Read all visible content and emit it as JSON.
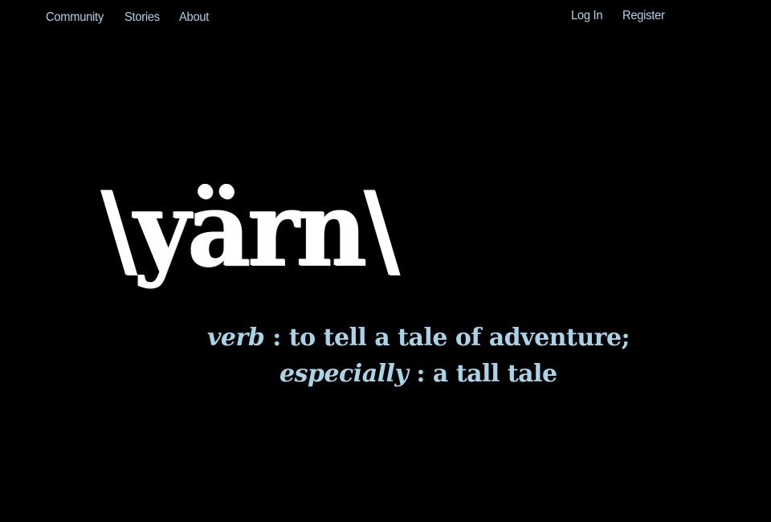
{
  "nav": {
    "left": [
      {
        "label": "Community"
      },
      {
        "label": "Stories"
      },
      {
        "label": "About"
      }
    ],
    "right": [
      {
        "label": "Log In"
      },
      {
        "label": "Register"
      }
    ]
  },
  "hero": {
    "logo_text": "\\yärn\\",
    "definition": [
      {
        "term": "verb",
        "separator": " : ",
        "text": "to tell a tale of adventure;"
      },
      {
        "term": "especially",
        "separator": " : ",
        "text": "a tall tale"
      }
    ]
  },
  "colors": {
    "background": "#000000",
    "logo": "#ffffff",
    "accent": "#a9d4e8"
  }
}
